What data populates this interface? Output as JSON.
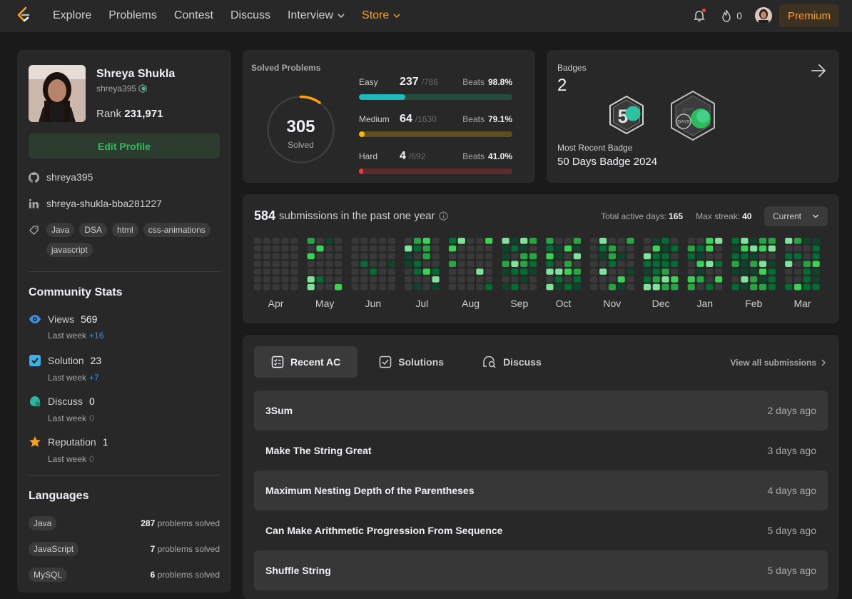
{
  "nav": {
    "items": [
      "Explore",
      "Problems",
      "Contest",
      "Discuss",
      "Interview"
    ],
    "store": "Store",
    "streak_count": "0",
    "premium": "Premium"
  },
  "profile": {
    "name": "Shreya Shukla",
    "username": "shreya395",
    "rank_label": "Rank",
    "rank": "231,971",
    "edit_button": "Edit Profile",
    "github": "shreya395",
    "linkedin": "shreya-shukla-bba281227",
    "skills": [
      "Java",
      "DSA",
      "html",
      "css-animations",
      "javascript"
    ]
  },
  "community": {
    "title": "Community Stats",
    "last_week_label": "Last week",
    "stats": [
      {
        "label": "Views",
        "value": "569",
        "delta": "+16"
      },
      {
        "label": "Solution",
        "value": "23",
        "delta": "+7"
      },
      {
        "label": "Discuss",
        "value": "0",
        "delta": "0"
      },
      {
        "label": "Reputation",
        "value": "1",
        "delta": "0"
      }
    ]
  },
  "languages": {
    "title": "Languages",
    "suffix": "problems solved",
    "items": [
      {
        "name": "Java",
        "count": "287"
      },
      {
        "name": "JavaScript",
        "count": "7"
      },
      {
        "name": "MySQL",
        "count": "6"
      }
    ]
  },
  "solved": {
    "title": "Solved Problems",
    "total": "305",
    "total_label": "Solved",
    "total_fraction": 0.0975,
    "beats_label": "Beats",
    "difficulties": [
      {
        "name": "Easy",
        "count": "237",
        "total": "/786",
        "beats": "98.8%",
        "fill": 0.3015,
        "color": "#1cbaba",
        "track": "#234d3f"
      },
      {
        "name": "Medium",
        "count": "64",
        "total": "/1630",
        "beats": "79.1%",
        "fill": 0.0393,
        "color": "#ffb700",
        "track": "#5e4e1e"
      },
      {
        "name": "Hard",
        "count": "4",
        "total": "/692",
        "beats": "41.0%",
        "fill": 0.0058,
        "color": "#f63737",
        "track": "#5a2c2c"
      }
    ]
  },
  "badges": {
    "label": "Badges",
    "count": "2",
    "recent_label": "Most Recent Badge",
    "recent_name": "50 Days Badge 2024",
    "badge_digit": "5",
    "badge_days": "DAYS"
  },
  "submissions": {
    "count": "584",
    "text": "submissions in the past one year",
    "active_days_label": "Total active days:",
    "active_days": "165",
    "max_streak_label": "Max streak:",
    "max_streak": "40",
    "year_select": "Current",
    "months": [
      "Apr",
      "May",
      "Jun",
      "Jul",
      "Aug",
      "Sep",
      "Oct",
      "Nov",
      "Dec",
      "Jan",
      "Feb",
      "Mar"
    ]
  },
  "recent": {
    "tabs": [
      "Recent AC",
      "Solutions",
      "Discuss"
    ],
    "view_all": "View all submissions",
    "items": [
      {
        "name": "3Sum",
        "time": "2 days ago"
      },
      {
        "name": "Make The String Great",
        "time": "3 days ago"
      },
      {
        "name": "Maximum Nesting Depth of the Parentheses",
        "time": "4 days ago"
      },
      {
        "name": "Can Make Arithmetic Progression From Sequence",
        "time": "5 days ago"
      },
      {
        "name": "Shuffle String",
        "time": "5 days ago"
      }
    ]
  },
  "colors": {
    "accent": "#ffa116",
    "green": "#2cbb5d",
    "heat_empty": "#393939",
    "heat_levels": [
      "#0e4429",
      "#006d32",
      "#26a641",
      "#39d353",
      "#7ee29a"
    ]
  }
}
